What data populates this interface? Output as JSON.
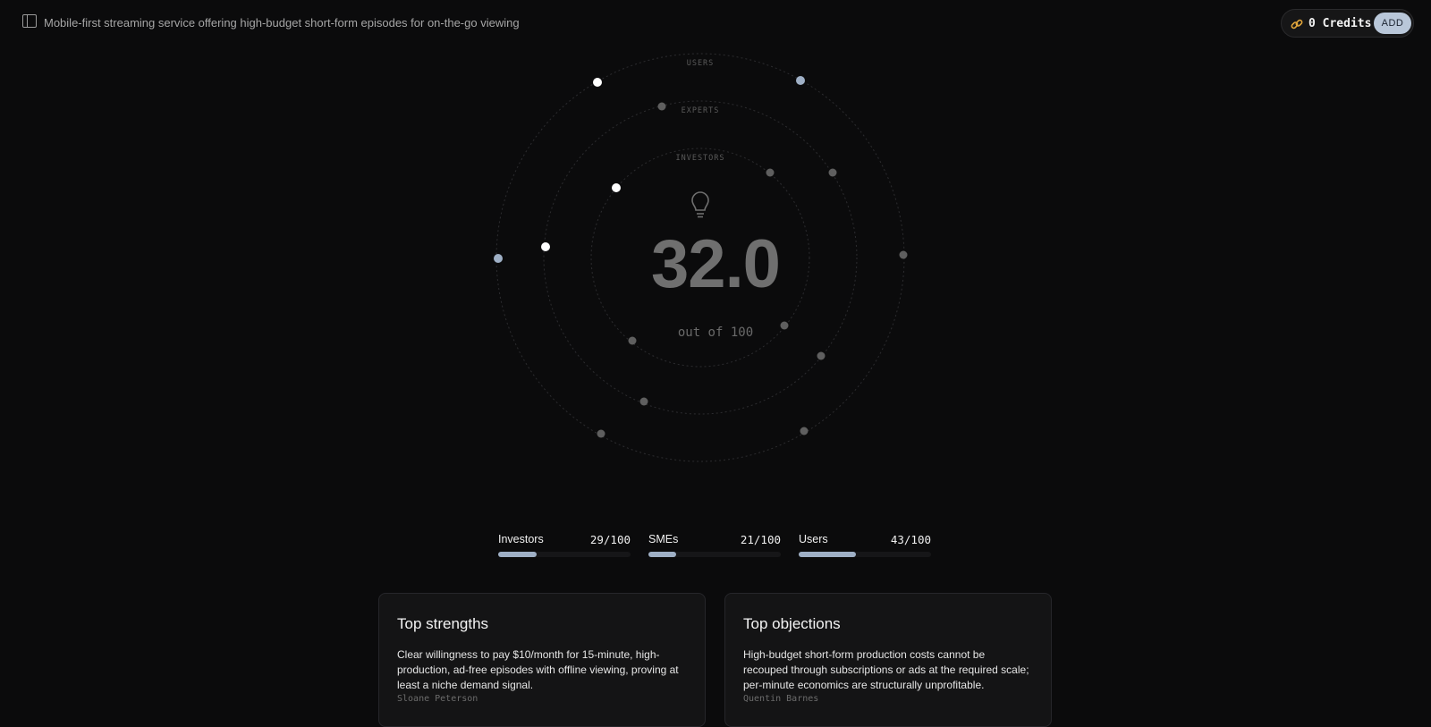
{
  "header": {
    "title": "Mobile-first streaming service offering high-budget short-form episodes for on-the-go viewing",
    "credits_label": "0 Credits",
    "add_label": "ADD",
    "sidebar_icon": "sidebar-toggle-icon",
    "credits_icon": "link-icon",
    "accent_color": "#e2a63b"
  },
  "radar": {
    "rings": [
      "USERS",
      "EXPERTS",
      "INVESTORS"
    ],
    "center_icon": "lightbulb-icon",
    "score": "32.0",
    "score_sub": "out of 100",
    "dot_colors": {
      "highlight": "#ffffff",
      "user": "#9fb0c6",
      "neutral": "#5f5f5f"
    }
  },
  "score_bars": [
    {
      "label": "Investors",
      "score_text": "29/100",
      "value": 29
    },
    {
      "label": "SMEs",
      "score_text": "21/100",
      "value": 21
    },
    {
      "label": "Users",
      "score_text": "43/100",
      "value": 43
    }
  ],
  "strengths": {
    "title": "Top strengths",
    "body": "Clear willingness to pay $10/month for 15-minute, high-production, ad-free episodes with offline viewing, proving at least a niche demand signal.",
    "author": "Sloane Peterson"
  },
  "objections": {
    "title": "Top objections",
    "body": "High-budget short-form production costs cannot be recouped through subscriptions or ads at the required scale; per-minute economics are structurally unprofitable.",
    "author": "Quentin Barnes"
  }
}
